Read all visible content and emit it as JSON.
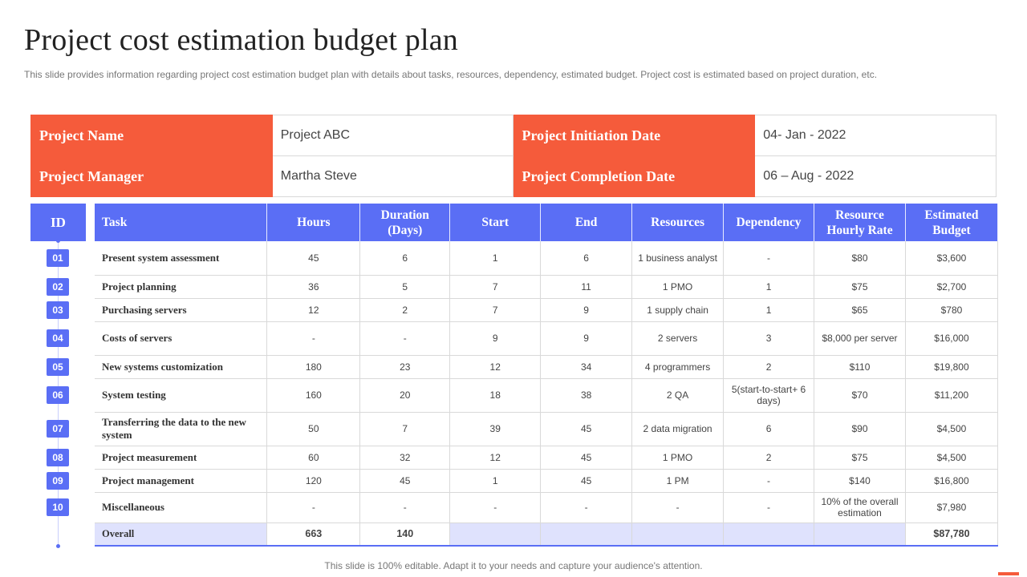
{
  "title": "Project cost estimation budget plan",
  "subtitle": "This slide provides information regarding project cost estimation budget plan with details about tasks, resources, dependency, estimated budget. Project cost is estimated based on project duration, etc.",
  "info": {
    "project_name_label": "Project Name",
    "project_name": "Project ABC",
    "initiation_label": "Project Initiation Date",
    "initiation": "04- Jan - 2022",
    "manager_label": "Project Manager",
    "manager": "Martha Steve",
    "completion_label": "Project Completion Date",
    "completion": "06 – Aug - 2022"
  },
  "id_header": "ID",
  "columns": [
    "Task",
    "Hours",
    "Duration (Days)",
    "Start",
    "End",
    "Resources",
    "Dependency",
    "Resource Hourly Rate",
    "Estimated Budget"
  ],
  "rows": [
    {
      "id": "01",
      "cells": [
        "Present system assessment",
        "45",
        "6",
        "1",
        "6",
        "1 business analyst",
        "-",
        "$80",
        "$3,600"
      ]
    },
    {
      "id": "02",
      "cells": [
        "Project planning",
        "36",
        "5",
        "7",
        "11",
        "1 PMO",
        "1",
        "$75",
        "$2,700"
      ]
    },
    {
      "id": "03",
      "cells": [
        "Purchasing servers",
        "12",
        "2",
        "7",
        "9",
        "1 supply chain",
        "1",
        "$65",
        "$780"
      ]
    },
    {
      "id": "04",
      "cells": [
        "Costs of servers",
        "-",
        "-",
        "9",
        "9",
        "2 servers",
        "3",
        "$8,000 per server",
        "$16,000"
      ]
    },
    {
      "id": "05",
      "cells": [
        "New systems customization",
        "180",
        "23",
        "12",
        "34",
        "4 programmers",
        "2",
        "$110",
        "$19,800"
      ]
    },
    {
      "id": "06",
      "cells": [
        "System testing",
        "160",
        "20",
        "18",
        "38",
        "2 QA",
        "5(start-to-start+ 6 days)",
        "$70",
        "$11,200"
      ]
    },
    {
      "id": "07",
      "cells": [
        "Transferring the data to the new system",
        "50",
        "7",
        "39",
        "45",
        "2 data migration",
        "6",
        "$90",
        "$4,500"
      ]
    },
    {
      "id": "08",
      "cells": [
        "Project measurement",
        "60",
        "32",
        "12",
        "45",
        "1 PMO",
        "2",
        "$75",
        "$4,500"
      ]
    },
    {
      "id": "09",
      "cells": [
        "Project management",
        "120",
        "45",
        "1",
        "45",
        "1 PM",
        "-",
        "$140",
        "$16,800"
      ]
    },
    {
      "id": "10",
      "cells": [
        "Miscellaneous",
        "-",
        "-",
        "-",
        "-",
        "-",
        "-",
        "10% of the overall estimation",
        "$7,980"
      ]
    }
  ],
  "overall": {
    "label": "Overall",
    "hours": "663",
    "duration": "140",
    "budget": "$87,780"
  },
  "footer": "This slide is 100% editable. Adapt it to your needs and capture your audience's attention.",
  "colors": {
    "accent_orange": "#f55b3b",
    "accent_blue": "#5a6ef5",
    "overall_fill": "#dfe2fd"
  }
}
